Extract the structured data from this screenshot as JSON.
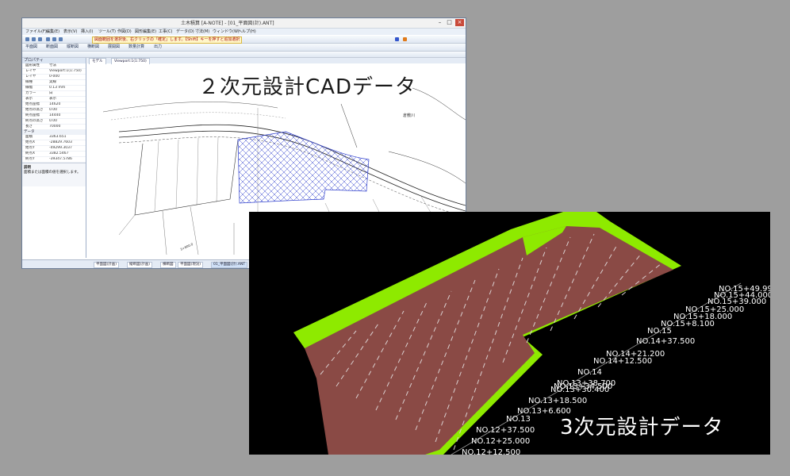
{
  "cad_window": {
    "title": "土木積算 [A-NOTE] - [01_平面図(計).ANT]",
    "menu": [
      "ファイル(F)",
      "編集(E)",
      "表示(V)",
      "挿入(I)",
      "ツール(T)",
      "作図(D)",
      "図形編集(E)",
      "工事(C)",
      "データ(D)",
      "寸法(M)",
      "ウィンドウ(W)",
      "ヘルプ(H)"
    ],
    "toolbar_warning": "図面範囲を選択後、右クリックの「確定」します。【Shift】キーを押すと追加選択",
    "toolbar_labels": [
      "平面図",
      "断面図",
      "縦断図",
      "横断図",
      "展開図",
      "数量計算",
      "出力"
    ],
    "tabs": [
      "モデル",
      "Viewport:1(1:750)"
    ],
    "panel_title": "プロパティ",
    "panel_rows": [
      {
        "k": "図形属性",
        "v": "寸法"
      },
      {
        "k": "レイヤ",
        "v": "Viewport:1(1:750)"
      },
      {
        "k": "レイヤ",
        "v": "0-000"
      },
      {
        "k": "線種",
        "v": "実線"
      },
      {
        "k": "線幅",
        "v": "0.13 mm"
      },
      {
        "k": "カラー",
        "v": "白"
      },
      {
        "k": "表示",
        "v": "表示"
      },
      {
        "k": "始点座標",
        "v": "14620"
      },
      {
        "k": "始点の高さ",
        "v": "0.00"
      },
      {
        "k": "終点座標",
        "v": "14440"
      },
      {
        "k": "終点の高さ",
        "v": "0.00"
      },
      {
        "k": "長さ",
        "v": "70000"
      }
    ],
    "panel_section": "データ",
    "panel_data": [
      {
        "k": "面積",
        "v": "3363.651"
      },
      {
        "k": "始点X",
        "v": "-28829.7603"
      },
      {
        "k": "始点Y",
        "v": "-49299.3037"
      },
      {
        "k": "終点X",
        "v": "3382.5467"
      },
      {
        "k": "終点Y",
        "v": "-39347.5786"
      }
    ],
    "panel_note_title": "説明",
    "panel_note": "面積または面積の値を選択します。",
    "bottom_tabs": [
      "平面図(計画)",
      "縦断図(計画)",
      "横断図",
      "平面図(現況)",
      "01_平面図(計).ANT"
    ],
    "drawing_labels": {
      "river": "倉敷川",
      "station": "3+800.0"
    }
  },
  "cad_label": "２次元設計CADデータ",
  "d3_label": "3次元設計データ",
  "stations": [
    "NO.15+49.99",
    "NO.15+44.000",
    "NO.15+39.000",
    "NO.15+25.000",
    "NO.15+18.000",
    "NO.15+8.100",
    "NO.15",
    "NO.14+37.500",
    "NO.14+21.200",
    "NO.14+12.500",
    "NO.14",
    "NO.13+38.700",
    "NO.13+34.500",
    "NO.13+30.400",
    "NO.13+18.500",
    "NO.13+6.600",
    "NO.13",
    "NO.12+37.500",
    "NO.12+25.000",
    "NO.12+12.500"
  ],
  "colors": {
    "background": "#9e9e9e",
    "surface_fill": "#8a4a45",
    "slope_green": "#8eea00",
    "hatch_blue": "#2f3fcc",
    "d3_bg": "#000000"
  }
}
